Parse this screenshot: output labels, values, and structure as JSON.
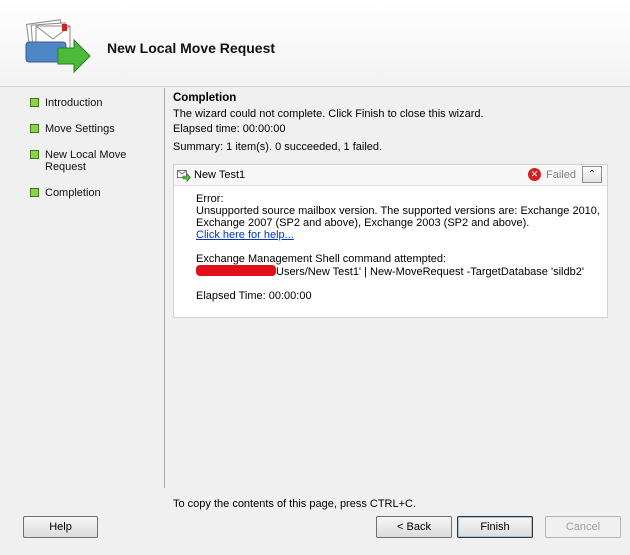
{
  "header": {
    "title": "New Local Move Request"
  },
  "steps": [
    {
      "label": "Introduction"
    },
    {
      "label": "Move Settings"
    },
    {
      "label": "New Local Move Request"
    },
    {
      "label": "Completion"
    }
  ],
  "step_color": "#8fd14b",
  "content": {
    "title": "Completion",
    "message": "The wizard could not complete. Click Finish to close this wizard.",
    "elapsed": "Elapsed time: 00:00:00",
    "summary": "Summary: 1 item(s). 0 succeeded, 1 failed."
  },
  "result": {
    "name": "New Test1",
    "status": "Failed",
    "status_color": "#d62020",
    "collapse_symbol": "⌃",
    "error_label": "Error:",
    "error_text": "Unsupported source mailbox version. The supported versions are: Exchange 2010, Exchange 2007 (SP2 and above), Exchange 2003 (SP2 and above).",
    "help_link": "Click here for help...",
    "command_label": "Exchange Management Shell command attempted:",
    "command_text": "Users/New Test1' | New-MoveRequest -TargetDatabase 'sildb2'",
    "elapsed": "Elapsed Time: 00:00:00"
  },
  "footer": {
    "copy_hint": "To copy the contents of this page, press CTRL+C.",
    "help": "Help",
    "back": "< Back",
    "finish": "Finish",
    "cancel": "Cancel"
  }
}
